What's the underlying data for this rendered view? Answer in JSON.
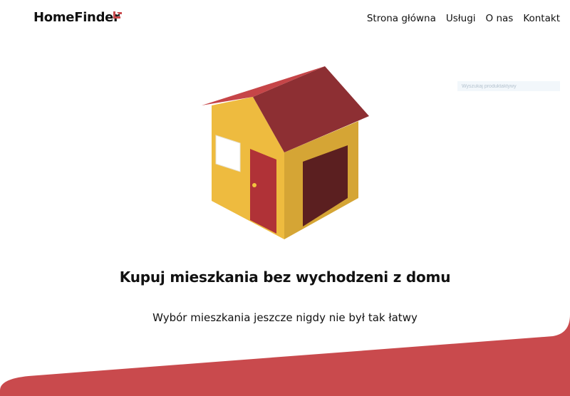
{
  "header": {
    "logo_text": "HomeFinder",
    "nav": [
      "Strona główna",
      "Usługi",
      "O nas",
      "Kontakt"
    ]
  },
  "search": {
    "placeholder": "Wyszukaj produktaktywy"
  },
  "hero": {
    "headline": "Kupuj mieszkania bez wychodzeni z domu",
    "subline": "Wybór mieszkania jeszcze nigdy nie był tak łatwy"
  },
  "colors": {
    "brand": "#c94a4d",
    "roof": "#8d2f33",
    "wall": "#e8b63c",
    "garage_door": "#5b1f20",
    "door": "#b03237"
  }
}
